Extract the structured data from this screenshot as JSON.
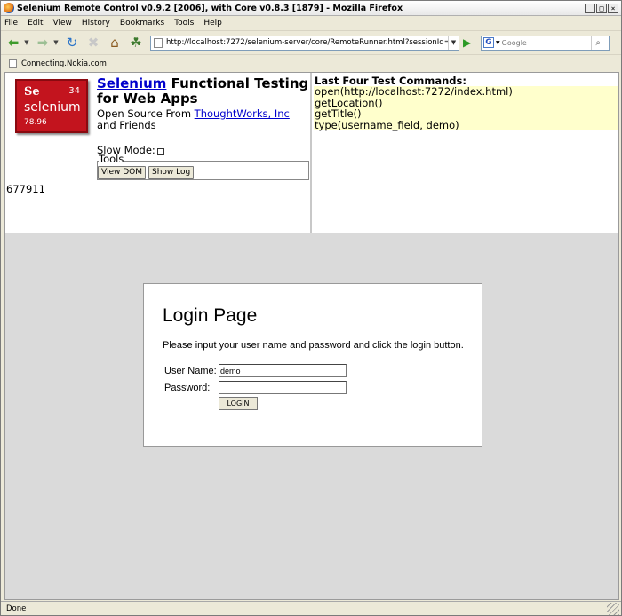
{
  "window": {
    "title": "Selenium Remote Control v0.9.2 [2006], with Core v0.8.3 [1879] - Mozilla Firefox",
    "minimize": "_",
    "maximize": "□",
    "close": "×"
  },
  "menubar": {
    "items": [
      "File",
      "Edit",
      "View",
      "History",
      "Bookmarks",
      "Tools",
      "Help"
    ]
  },
  "navbar": {
    "url": "http://localhost:7272/selenium-server/core/RemoteRunner.html?sessionId=677911&multiWind",
    "search_placeholder": "Google"
  },
  "bookmarks": {
    "item": "Connecting.Nokia.com"
  },
  "selenium": {
    "logo_symbol": "Se",
    "logo_number": "34",
    "logo_word": "selenium",
    "logo_mass": "78.96",
    "heading_link": "Selenium",
    "heading_text": " Functional Testing for Web Apps",
    "subtitle_prefix": "Open Source From ",
    "subtitle_link": "ThoughtWorks, Inc",
    "subtitle_suffix": " and Friends",
    "slow_mode_label": "Slow Mode:",
    "tools_legend": "Tools",
    "view_dom_label": "View DOM",
    "show_log_label": "Show Log",
    "session_id": "677911"
  },
  "commands": {
    "title": "Last Four Test Commands:",
    "items": [
      "open(http://localhost:7272/index.html)",
      "getLocation()",
      "getTitle()",
      "type(username_field, demo)"
    ]
  },
  "login": {
    "title": "Login Page",
    "message": "Please input your user name and password and click the login button.",
    "username_label": "User Name:",
    "username_value": "demo",
    "password_label": "Password:",
    "password_value": "",
    "button_label": "LOGIN"
  },
  "status": {
    "text": "Done"
  }
}
